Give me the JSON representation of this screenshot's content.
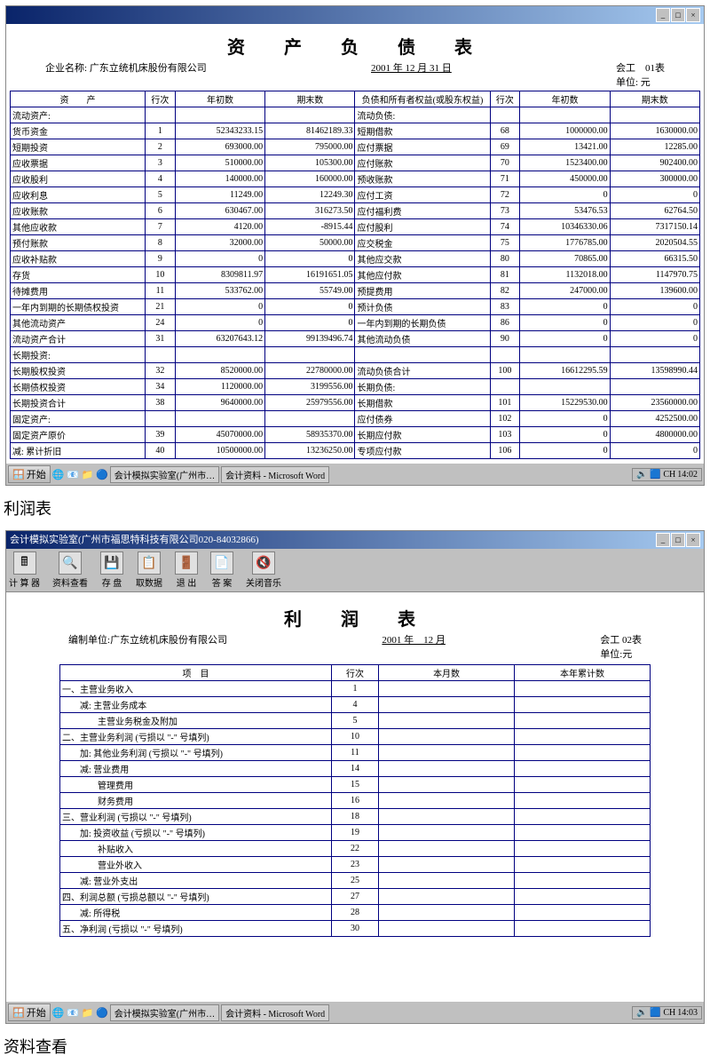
{
  "win1": {
    "title": "",
    "ctrls": [
      "_",
      "□",
      "×"
    ],
    "sheet_title": "资　产　负　债　表",
    "meta": {
      "company_label": "企业名称:",
      "company": "广东立统机床股份有限公司",
      "date": "  2001 年 12 月 31 日  ",
      "form": "会工　01表",
      "unit": "单位:  元"
    },
    "headers": {
      "asset": "资　　产",
      "row": "行次",
      "begin": "年初数",
      "end": "期末数",
      "liab": "负债和所有者权益(或股东权益)",
      "row2": "行次",
      "begin2": "年初数",
      "end2": "期末数"
    },
    "rows": [
      {
        "a": "流动资产:",
        "r": "",
        "b": "",
        "e": "",
        "l": "流动负债:",
        "r2": "",
        "b2": "",
        "e2": ""
      },
      {
        "a": "货币资金",
        "r": "1",
        "b": "52343233.15",
        "e": "81462189.33",
        "l": "短期借款",
        "r2": "68",
        "b2": "1000000.00",
        "e2": "1630000.00"
      },
      {
        "a": "短期投资",
        "r": "2",
        "b": "693000.00",
        "e": "795000.00",
        "l": "应付票据",
        "r2": "69",
        "b2": "13421.00",
        "e2": "12285.00"
      },
      {
        "a": "应收票据",
        "r": "3",
        "b": "510000.00",
        "e": "105300.00",
        "l": "应付账款",
        "r2": "70",
        "b2": "1523400.00",
        "e2": "902400.00"
      },
      {
        "a": "应收股利",
        "r": "4",
        "b": "140000.00",
        "e": "160000.00",
        "l": "预收账款",
        "r2": "71",
        "b2": "450000.00",
        "e2": "300000.00"
      },
      {
        "a": "应收利息",
        "r": "5",
        "b": "11249.00",
        "e": "12249.30",
        "l": "应付工资",
        "r2": "72",
        "b2": "0",
        "e2": "0"
      },
      {
        "a": "应收账款",
        "r": "6",
        "b": "630467.00",
        "e": "316273.50",
        "l": "应付福利费",
        "r2": "73",
        "b2": "53476.53",
        "e2": "62764.50"
      },
      {
        "a": "其他应收款",
        "r": "7",
        "b": "4120.00",
        "e": "-8915.44",
        "l": "应付股利",
        "r2": "74",
        "b2": "10346330.06",
        "e2": "7317150.14"
      },
      {
        "a": "预付账款",
        "r": "8",
        "b": "32000.00",
        "e": "50000.00",
        "l": "应交税金",
        "r2": "75",
        "b2": "1776785.00",
        "e2": "2020504.55"
      },
      {
        "a": "应收补贴款",
        "r": "9",
        "b": "0",
        "e": "0",
        "l": "其他应交款",
        "r2": "80",
        "b2": "70865.00",
        "e2": "66315.50"
      },
      {
        "a": "存货",
        "r": "10",
        "b": "8309811.97",
        "e": "16191651.05",
        "l": "其他应付款",
        "r2": "81",
        "b2": "1132018.00",
        "e2": "1147970.75"
      },
      {
        "a": "待摊费用",
        "r": "11",
        "b": "533762.00",
        "e": "55749.00",
        "l": "预提费用",
        "r2": "82",
        "b2": "247000.00",
        "e2": "139600.00"
      },
      {
        "a": "一年内到期的长期债权投资",
        "r": "21",
        "b": "0",
        "e": "0",
        "l": "预计负债",
        "r2": "83",
        "b2": "0",
        "e2": "0"
      },
      {
        "a": "其他流动资产",
        "r": "24",
        "b": "0",
        "e": "0",
        "l": "一年内到期的长期负债",
        "r2": "86",
        "b2": "0",
        "e2": "0"
      },
      {
        "a": "流动资产合计",
        "r": "31",
        "b": "63207643.12",
        "e": "99139496.74",
        "l": "其他流动负债",
        "r2": "90",
        "b2": "0",
        "e2": "0"
      },
      {
        "a": "长期投资:",
        "r": "",
        "b": "",
        "e": "",
        "l": "",
        "r2": "",
        "b2": "",
        "e2": ""
      },
      {
        "a": "长期股权投资",
        "r": "32",
        "b": "8520000.00",
        "e": "22780000.00",
        "l": "流动负债合计",
        "r2": "100",
        "b2": "16612295.59",
        "e2": "13598990.44"
      },
      {
        "a": "长期债权投资",
        "r": "34",
        "b": "1120000.00",
        "e": "3199556.00",
        "l": "长期负债:",
        "r2": "",
        "b2": "",
        "e2": ""
      },
      {
        "a": "长期投资合计",
        "r": "38",
        "b": "9640000.00",
        "e": "25979556.00",
        "l": "长期借款",
        "r2": "101",
        "b2": "15229530.00",
        "e2": "23560000.00"
      },
      {
        "a": "固定资产:",
        "r": "",
        "b": "",
        "e": "",
        "l": "应付债券",
        "r2": "102",
        "b2": "0",
        "e2": "4252500.00"
      },
      {
        "a": "固定资产原价",
        "r": "39",
        "b": "45070000.00",
        "e": "58935370.00",
        "l": "长期应付款",
        "r2": "103",
        "b2": "0",
        "e2": "4800000.00"
      },
      {
        "a": "减: 累计折旧",
        "r": "40",
        "b": "10500000.00",
        "e": "13236250.00",
        "l": "专项应付款",
        "r2": "106",
        "b2": "0",
        "e2": "0"
      }
    ],
    "taskbar": {
      "start": "开始",
      "q": [
        "🌐",
        "📧",
        "📁",
        "🔵"
      ],
      "btn1": "会计模拟实验室(广州市…",
      "btn2": "会计资料 - Microsoft Word",
      "tray": [
        "🔊",
        "🟦",
        "CH"
      ],
      "time": "14:02"
    }
  },
  "label1": "利润表",
  "win2": {
    "title": "会计模拟实验室(广州市福思特科技有限公司020-84032866)",
    "ctrls": [
      "_",
      "□",
      "×"
    ],
    "tools": [
      {
        "i": "🖩",
        "t": "计 算 器"
      },
      {
        "i": "🔍",
        "t": "资料查看"
      },
      {
        "i": "💾",
        "t": "存  盘"
      },
      {
        "i": "📋",
        "t": "取数据"
      },
      {
        "i": "🚪",
        "t": "退  出"
      },
      {
        "i": "📄",
        "t": "答  案"
      },
      {
        "i": "🔇",
        "t": "关闭音乐"
      }
    ],
    "sheet_title": "利　润　表",
    "meta": {
      "company_label": "编制单位:",
      "company": "广东立统机床股份有限公司",
      "date": "  2001  年　12  月",
      "form": "会工 02表",
      "unit": "单位:元"
    },
    "headers": {
      "item": "项　目",
      "row": "行次",
      "month": "本月数",
      "year": "本年累计数"
    },
    "rows": [
      {
        "i": "一、主营业务收入",
        "r": "1",
        "m": "",
        "y": ""
      },
      {
        "i": "　　减: 主营业务成本",
        "r": "4",
        "m": "",
        "y": ""
      },
      {
        "i": "　　　　主营业务税金及附加",
        "r": "5",
        "m": "",
        "y": ""
      },
      {
        "i": "二、主营业务利润 (亏损以 \"-\" 号填列)",
        "r": "10",
        "m": "",
        "y": ""
      },
      {
        "i": "　　加: 其他业务利润 (亏损以 \"-\" 号填列)",
        "r": "11",
        "m": "",
        "y": ""
      },
      {
        "i": "　　减: 营业费用",
        "r": "14",
        "m": "",
        "y": ""
      },
      {
        "i": "　　　　管理费用",
        "r": "15",
        "m": "",
        "y": ""
      },
      {
        "i": "　　　　财务费用",
        "r": "16",
        "m": "",
        "y": ""
      },
      {
        "i": "三、营业利润 (亏损以 \"-\" 号填列)",
        "r": "18",
        "m": "",
        "y": ""
      },
      {
        "i": "　　加: 投资收益 (亏损以 \"-\" 号填列)",
        "r": "19",
        "m": "",
        "y": ""
      },
      {
        "i": "　　　　补贴收入",
        "r": "22",
        "m": "",
        "y": ""
      },
      {
        "i": "　　　　营业外收入",
        "r": "23",
        "m": "",
        "y": ""
      },
      {
        "i": "　　减: 营业外支出",
        "r": "25",
        "m": "",
        "y": ""
      },
      {
        "i": "四、利润总额 (亏损总额以 \"-\" 号填列)",
        "r": "27",
        "m": "",
        "y": ""
      },
      {
        "i": "　　减: 所得税",
        "r": "28",
        "m": "",
        "y": ""
      },
      {
        "i": "五、净利润 (亏损以 \"-\" 号填列)",
        "r": "30",
        "m": "",
        "y": ""
      }
    ],
    "taskbar": {
      "start": "开始",
      "q": [
        "🌐",
        "📧",
        "📁",
        "🔵"
      ],
      "btn1": "会计模拟实验室(广州市…",
      "btn2": "会计资料 - Microsoft Word",
      "tray": [
        "🔊",
        "🟦",
        "CH"
      ],
      "time": "14:03"
    }
  },
  "label2": "资料查看",
  "chart_data": {
    "type": "table",
    "title": "资产负债表 (Balance Sheet) 2001-12-31, 广东立统机床股份有限公司, 单位:元",
    "columns": [
      "资产",
      "行次",
      "年初数",
      "期末数",
      "负债和所有者权益",
      "行次",
      "年初数",
      "期末数"
    ],
    "rows": [
      [
        "货币资金",
        1,
        52343233.15,
        81462189.33,
        "短期借款",
        68,
        1000000.0,
        1630000.0
      ],
      [
        "短期投资",
        2,
        693000.0,
        795000.0,
        "应付票据",
        69,
        13421.0,
        12285.0
      ],
      [
        "应收票据",
        3,
        510000.0,
        105300.0,
        "应付账款",
        70,
        1523400.0,
        902400.0
      ],
      [
        "应收股利",
        4,
        140000.0,
        160000.0,
        "预收账款",
        71,
        450000.0,
        300000.0
      ],
      [
        "应收利息",
        5,
        11249.0,
        12249.3,
        "应付工资",
        72,
        0,
        0
      ],
      [
        "应收账款",
        6,
        630467.0,
        316273.5,
        "应付福利费",
        73,
        53476.53,
        62764.5
      ],
      [
        "其他应收款",
        7,
        4120.0,
        -8915.44,
        "应付股利",
        74,
        10346330.06,
        7317150.14
      ],
      [
        "预付账款",
        8,
        32000.0,
        50000.0,
        "应交税金",
        75,
        1776785.0,
        2020504.55
      ],
      [
        "应收补贴款",
        9,
        0,
        0,
        "其他应交款",
        80,
        70865.0,
        66315.5
      ],
      [
        "存货",
        10,
        8309811.97,
        16191651.05,
        "其他应付款",
        81,
        1132018.0,
        1147970.75
      ],
      [
        "待摊费用",
        11,
        533762.0,
        55749.0,
        "预提费用",
        82,
        247000.0,
        139600.0
      ],
      [
        "一年内到期的长期债权投资",
        21,
        0,
        0,
        "预计负债",
        83,
        0,
        0
      ],
      [
        "其他流动资产",
        24,
        0,
        0,
        "一年内到期的长期负债",
        86,
        0,
        0
      ],
      [
        "流动资产合计",
        31,
        63207643.12,
        99139496.74,
        "其他流动负债",
        90,
        0,
        0
      ],
      [
        "长期股权投资",
        32,
        8520000.0,
        22780000.0,
        "流动负债合计",
        100,
        16612295.59,
        13598990.44
      ],
      [
        "长期债权投资",
        34,
        1120000.0,
        3199556.0,
        "长期借款",
        101,
        15229530.0,
        23560000.0
      ],
      [
        "长期投资合计",
        38,
        9640000.0,
        25979556.0,
        "应付债券",
        102,
        0,
        4252500.0
      ],
      [
        "固定资产原价",
        39,
        45070000.0,
        58935370.0,
        "长期应付款",
        103,
        0,
        4800000.0
      ],
      [
        "减:累计折旧",
        40,
        10500000.0,
        13236250.0,
        "专项应付款",
        106,
        0,
        0
      ]
    ]
  }
}
